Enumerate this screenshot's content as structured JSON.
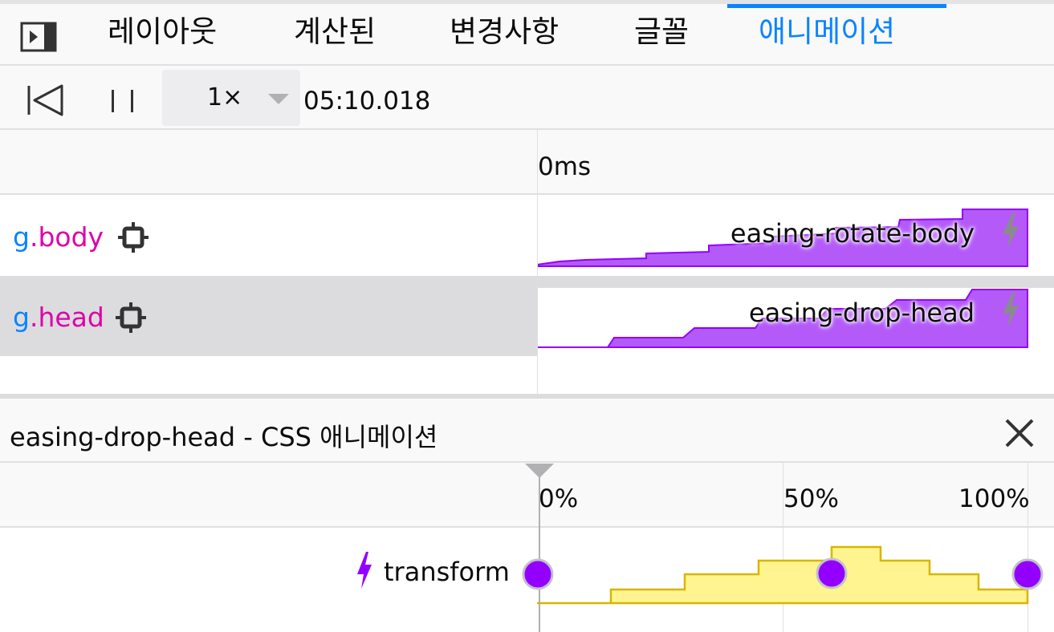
{
  "tabs": [
    {
      "label": "레이아웃",
      "selected": false
    },
    {
      "label": "계산된",
      "selected": false
    },
    {
      "label": "변경사항",
      "selected": false
    },
    {
      "label": "글꼴",
      "selected": false
    },
    {
      "label": "애니메이션",
      "selected": true
    }
  ],
  "toolbar": {
    "playback_rate": "1×",
    "current_time": "05:10.018"
  },
  "timeline": {
    "start_tick": "0ms",
    "animations": [
      {
        "element_prefix": "g",
        "element_class": ".body",
        "name": "easing-rotate-body",
        "selected": false
      },
      {
        "element_prefix": "g",
        "element_class": ".head",
        "name": "easing-drop-head",
        "selected": true
      }
    ]
  },
  "details": {
    "title": "easing-drop-head - CSS 애니메이션",
    "progress_ticks": [
      "0%",
      "50%",
      "100%"
    ],
    "property": "transform"
  },
  "colors": {
    "accent": "#0a84ff",
    "animation_fill": "#b45af9",
    "animation_stroke": "#9400ff",
    "keyframe": "#9400ff",
    "graph_fill": "#fff48f",
    "graph_stroke": "#d7b600",
    "tag_class": "#dd00a9"
  },
  "icons": [
    "sidebar-toggle-icon",
    "rewind-icon",
    "pause-icon",
    "dropdown-arrow-icon",
    "crosshair-icon",
    "lightning-icon",
    "close-icon"
  ]
}
